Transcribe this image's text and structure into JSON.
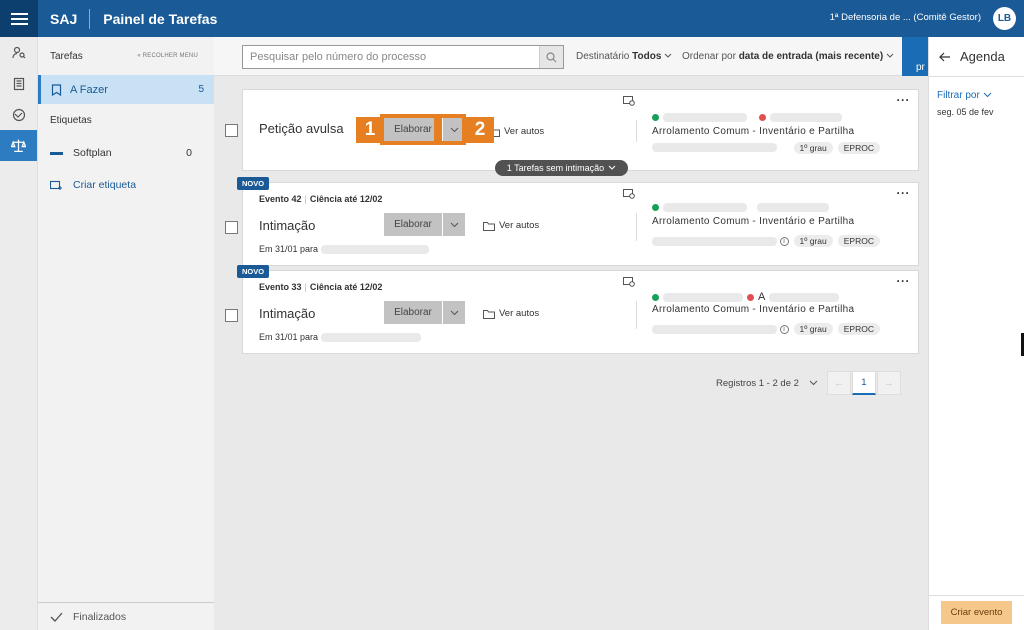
{
  "header": {
    "brand": "SAJ",
    "title": "Painel de Tarefas",
    "unit": "1ª Defensoria de ... (Comitê Gestor)",
    "avatar_initials": "LB"
  },
  "rail": {
    "icons": [
      "user-search-icon",
      "document-list-icon",
      "handshake-icon",
      "scales-icon"
    ],
    "active_index": 3
  },
  "sidemenu": {
    "title": "Tarefas",
    "collapse_label": "RECOLHER MENU",
    "todo": {
      "label": "A Fazer",
      "count": "5"
    },
    "labels_heading": "Etiquetas",
    "tags": [
      {
        "label": "Softplan",
        "count": "0",
        "color": "#1a5a96"
      }
    ],
    "create_tag": "Criar etiqueta",
    "finished": "Finalizados"
  },
  "filterbar": {
    "search_placeholder": "Pesquisar pelo número do processo",
    "dest_label": "Destinatário",
    "dest_value": "Todos",
    "order_label": "Ordenar por",
    "order_value": "data de entrada (mais recente)"
  },
  "cards": [
    {
      "title": "Petição avulsa",
      "button": "Elaborar",
      "view": "Ver autos",
      "class": "Arrolamento Comum - Inventário e Partilha",
      "badges": [
        "1º grau",
        "EPROC"
      ],
      "pill": "1 Tarefas sem intimação"
    },
    {
      "novo": "NOVO",
      "event": "Evento 42",
      "deadline": "Ciência até 12/02",
      "title": "Intimação",
      "button": "Elaborar",
      "view": "Ver autos",
      "sent": "Em 31/01 para",
      "class": "Arrolamento Comum - Inventário e Partilha",
      "badges": [
        "1º grau",
        "EPROC"
      ]
    },
    {
      "novo": "NOVO",
      "event": "Evento 33",
      "deadline": "Ciência até 12/02",
      "title": "Intimação",
      "button": "Elaborar",
      "view": "Ver autos",
      "sent": "Em 31/01 para",
      "party_fragment": "A",
      "class": "Arrolamento Comum - Inventário e Partilha",
      "badges": [
        "1º grau",
        "EPROC"
      ]
    }
  ],
  "tutorial": {
    "step1": "1",
    "step2": "2",
    "color": "#e67e22"
  },
  "pagination": {
    "summary": "Registros 1 - 2 de 2",
    "current": "1"
  },
  "agenda": {
    "title": "Agenda",
    "filter": "Filtrar por",
    "date": "seg. 05 de fev",
    "create": "Criar evento"
  }
}
